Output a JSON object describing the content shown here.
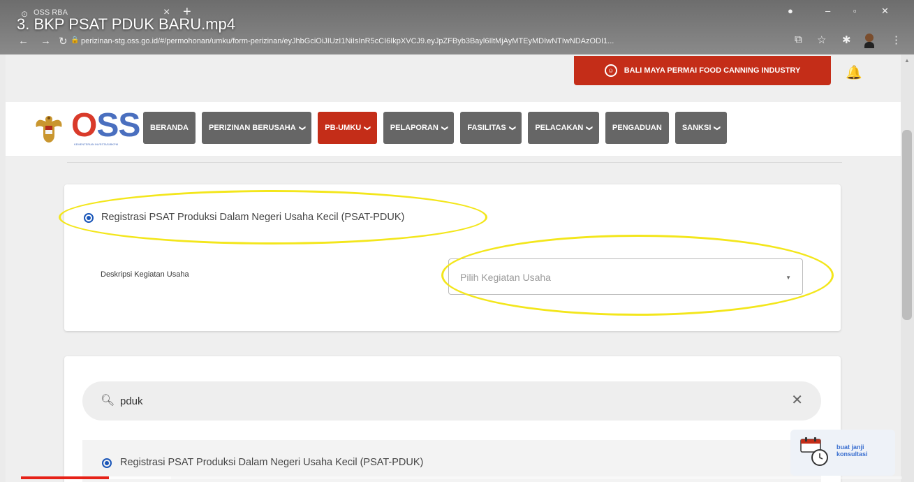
{
  "video": {
    "title": "3. BKP PSAT PDUK BARU.mp4",
    "progress_played": 0.1,
    "progress_buffered": 0.17
  },
  "browser": {
    "tab_title": "OSS RBA",
    "url": "perizinan-stg.oss.go.id/#/permohonan/umku/form-perizinan/eyJhbGciOiJIUzI1NiIsInR5cCI6IkpXVCJ9.eyJpZFByb3Bayl6IltMjAyMTEyMDIwNTIwNDAzODI1..."
  },
  "header": {
    "company_name": "BALI MAYA PERMAI FOOD CANNING INDUSTRY"
  },
  "logo": {
    "text_o": "O",
    "text_ss": "SS",
    "subtitle": "KEMENTERIAN INVESTASI/BKPM"
  },
  "menu": [
    {
      "label": "BERANDA",
      "dropdown": false,
      "active": false
    },
    {
      "label": "PERIZINAN BERUSAHA",
      "dropdown": true,
      "active": false
    },
    {
      "label": "PB-UMKU",
      "dropdown": true,
      "active": true
    },
    {
      "label": "PELAPORAN",
      "dropdown": true,
      "active": false
    },
    {
      "label": "FASILITAS",
      "dropdown": true,
      "active": false
    },
    {
      "label": "PELACAKAN",
      "dropdown": true,
      "active": false
    },
    {
      "label": "PENGADUAN",
      "dropdown": false,
      "active": false
    },
    {
      "label": "SANKSI",
      "dropdown": true,
      "active": false
    }
  ],
  "form": {
    "option_label": "Registrasi PSAT Produksi Dalam Negeri Usaha Kecil (PSAT-PDUK)",
    "field_label": "Deskripsi Kegiatan Usaha",
    "select_placeholder": "Pilih Kegiatan Usaha"
  },
  "search": {
    "value": "pduk"
  },
  "results": [
    {
      "label": "Registrasi PSAT Produksi Dalam Negeri Usaha Kecil (PSAT-PDUK)"
    }
  ],
  "consult": {
    "label": "buat janji konsultasi"
  },
  "colors": {
    "brand_red": "#c42d18",
    "menu_gray": "#666666",
    "accent_blue": "#1a56b8",
    "annotation_yellow": "#f3e61b"
  }
}
